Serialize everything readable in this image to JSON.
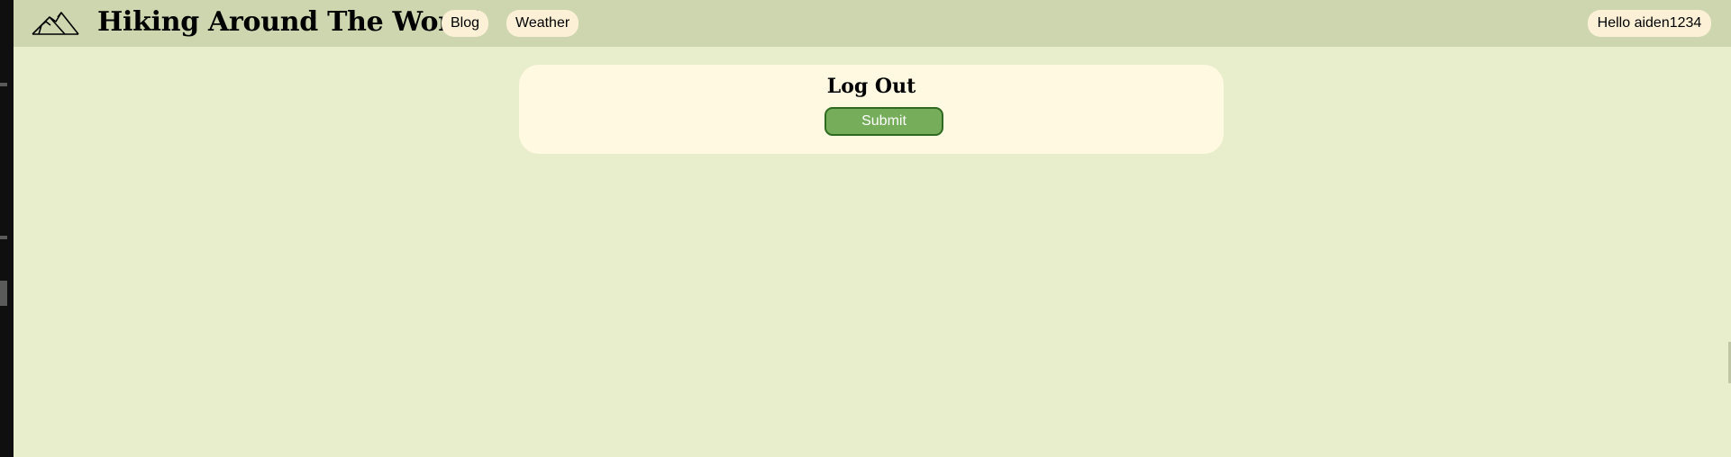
{
  "header": {
    "site_title": "Hiking Around The World",
    "logo_icon": "mountain-icon",
    "nav": [
      {
        "label": "Blog"
      },
      {
        "label": "Weather"
      }
    ],
    "user_greeting": "Hello aiden1234"
  },
  "logout_form": {
    "title": "Log Out",
    "submit_label": "Submit"
  },
  "colors": {
    "navbar_bg": "#cdd6ae",
    "page_bg": "#e8edcc",
    "pill_bg": "#fcf1d6",
    "card_bg": "#fef9e0",
    "submit_bg": "#76ad5b",
    "submit_border": "#2f6a1f"
  }
}
